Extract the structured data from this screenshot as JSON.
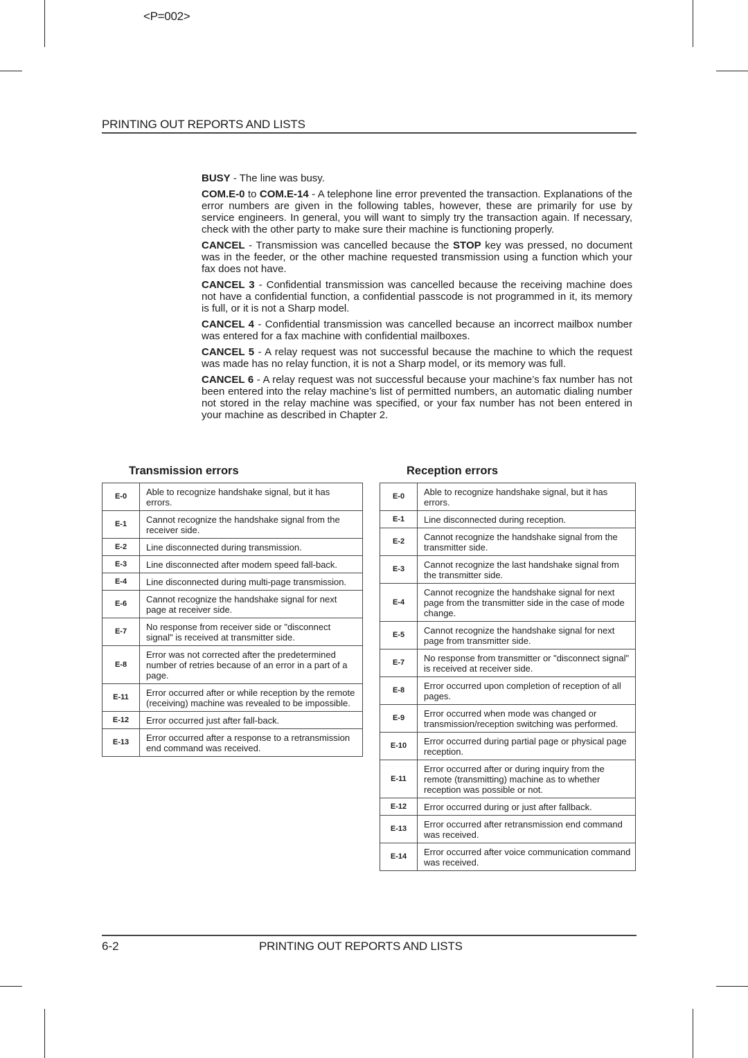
{
  "page_code": "<P=002>",
  "header": {
    "title": "PRINTING OUT REPORTS AND LISTS"
  },
  "body": {
    "busy": {
      "term": "BUSY",
      "text": " - The line was busy."
    },
    "com": {
      "term1": "COM.E-0",
      "mid": " to ",
      "term2": "COM.E-14",
      "text": " - A telephone line error prevented the transaction. Explanations of the error numbers are given in the following tables, however, these are primarily for use by service engineers. In general, you will want to simply try the transaction again. If necessary, check with the other party to make sure their machine is functioning properly."
    },
    "cancel": {
      "term": "CANCEL",
      "text1": " - Transmission was cancelled because the ",
      "key": "STOP",
      "text2": " key was pressed, no document was in the feeder, or the other machine requested transmission using a function which your fax does not have."
    },
    "cancel3": {
      "term": "CANCEL 3",
      "text": " - Confidential transmission was cancelled because the receiving machine does not have a confidential function, a confidential passcode is not programmed in it, its memory is full, or it is not a Sharp model."
    },
    "cancel4": {
      "term": "CANCEL 4",
      "text": " - Confidential transmission was cancelled because an incorrect mailbox number was entered for a fax machine with confidential mailboxes."
    },
    "cancel5": {
      "term": "CANCEL 5",
      "text": " - A relay request was not successful because the machine to which the request was made has no relay function, it is not a Sharp model, or its memory was full."
    },
    "cancel6": {
      "term": "CANCEL 6",
      "text": " - A relay request was not successful because your machine’s fax number has not been entered into the relay machine’s list of permitted numbers, an automatic dialing number not stored in the relay machine was specified, or your fax number has not been entered in your machine as described in Chapter 2."
    }
  },
  "transmission_errors": {
    "title": "Transmission errors",
    "rows": [
      {
        "code": "E-0",
        "desc": "Able to recognize handshake signal, but it has errors."
      },
      {
        "code": "E-1",
        "desc": "Cannot recognize the handshake signal from the receiver side."
      },
      {
        "code": "E-2",
        "desc": "Line disconnected during transmission."
      },
      {
        "code": "E-3",
        "desc": "Line disconnected after modem speed fall-back."
      },
      {
        "code": "E-4",
        "desc": "Line disconnected during multi-page transmission."
      },
      {
        "code": "E-6",
        "desc": "Cannot recognize the handshake signal for next page at receiver side."
      },
      {
        "code": "E-7",
        "desc": "No response from receiver side or \"disconnect signal\" is received at transmitter side."
      },
      {
        "code": "E-8",
        "desc": "Error was not corrected after the predetermined number of retries because of an error in a part of a page."
      },
      {
        "code": "E-11",
        "desc": "Error occurred after or while reception by the remote (receiving) machine was revealed to be impossible."
      },
      {
        "code": "E-12",
        "desc": "Error occurred just after fall-back."
      },
      {
        "code": "E-13",
        "desc": "Error occurred after a response to a retransmission end command was received."
      }
    ]
  },
  "reception_errors": {
    "title": "Reception errors",
    "rows": [
      {
        "code": "E-0",
        "desc": "Able to recognize handshake signal, but it has errors."
      },
      {
        "code": "E-1",
        "desc": "Line disconnected during reception."
      },
      {
        "code": "E-2",
        "desc": "Cannot recognize the handshake signal from the transmitter side."
      },
      {
        "code": "E-3",
        "desc": "Cannot recognize the last handshake signal from the transmitter side."
      },
      {
        "code": "E-4",
        "desc": "Cannot recognize the handshake signal for next page from the transmitter side in the case of mode change."
      },
      {
        "code": "E-5",
        "desc": "Cannot recognize the handshake signal for next page from transmitter side."
      },
      {
        "code": "E-7",
        "desc": "No response from transmitter or \"disconnect signal\" is received at receiver side."
      },
      {
        "code": "E-8",
        "desc": "Error occurred upon completion of reception of all pages."
      },
      {
        "code": "E-9",
        "desc": "Error occurred when mode was changed or transmission/reception switching was performed."
      },
      {
        "code": "E-10",
        "desc": "Error occurred during partial page or physical page reception."
      },
      {
        "code": "E-11",
        "desc": "Error occurred after or during inquiry from the remote (transmitting) machine as to whether reception was possible or not."
      },
      {
        "code": "E-12",
        "desc": "Error occurred during or just after fallback."
      },
      {
        "code": "E-13",
        "desc": "Error occurred after retransmission end command was received."
      },
      {
        "code": "E-14",
        "desc": "Error occurred after voice communication command was received."
      }
    ]
  },
  "footer": {
    "page_number": "6-2",
    "title": "PRINTING OUT REPORTS AND LISTS"
  }
}
